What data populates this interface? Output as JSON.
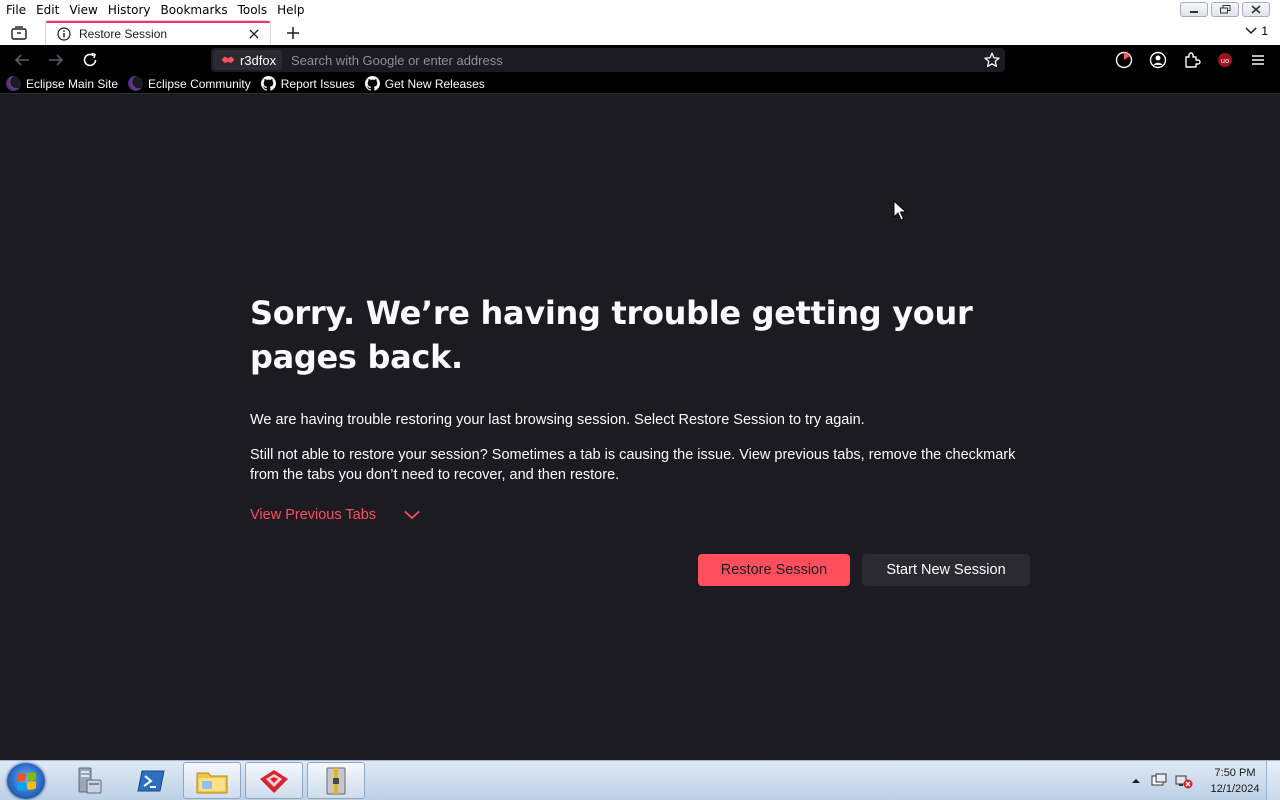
{
  "menubar": {
    "items": [
      {
        "label": "File"
      },
      {
        "label": "Edit"
      },
      {
        "label": "View"
      },
      {
        "label": "History"
      },
      {
        "label": "Bookmarks"
      },
      {
        "label": "Tools"
      },
      {
        "label": "Help"
      }
    ]
  },
  "tabs": {
    "active_title": "Restore Session",
    "all_tabs_count": "1"
  },
  "navbar": {
    "identity_label": "r3dfox",
    "url_placeholder": "Search with Google or enter address"
  },
  "bookmarks": [
    {
      "label": "Eclipse Main Site",
      "icon": "eclipse-moon-icon"
    },
    {
      "label": "Eclipse Community",
      "icon": "eclipse-moon-icon"
    },
    {
      "label": "Report Issues",
      "icon": "github-icon"
    },
    {
      "label": "Get New Releases",
      "icon": "github-icon"
    }
  ],
  "content": {
    "heading": "Sorry. We’re having trouble getting your pages back.",
    "para1": "We are having trouble restoring your last browsing session. Select Restore Session to try again.",
    "para2": "Still not able to restore your session? Sometimes a tab is causing the issue. View previous tabs, remove the checkmark from the tabs you don’t need to recover, and then restore.",
    "view_previous": "View Previous Tabs",
    "restore_button": "Restore Session",
    "new_session_button": "Start New Session"
  },
  "taskbar": {
    "time": "7:50 PM",
    "date": "12/1/2024"
  },
  "colors": {
    "page_bg": "#1c1b22",
    "accent": "#ff4f5e",
    "tab_highlight": "#ff2e63"
  }
}
